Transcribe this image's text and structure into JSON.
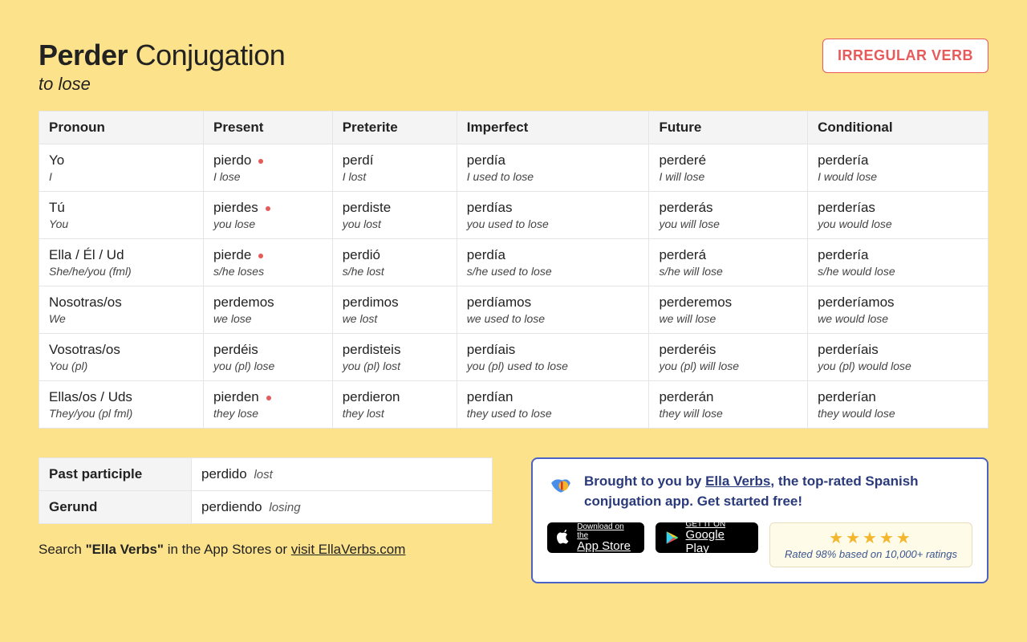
{
  "header": {
    "verb": "Perder",
    "word_conjugation": "Conjugation",
    "translation": "to lose",
    "badge": "IRREGULAR VERB"
  },
  "columns": [
    "Pronoun",
    "Present",
    "Preterite",
    "Imperfect",
    "Future",
    "Conditional"
  ],
  "rows": [
    {
      "pronoun": {
        "es": "Yo",
        "en": "I"
      },
      "present": {
        "es": "pierdo",
        "en": "I lose",
        "irregular": true
      },
      "preterite": {
        "es": "perdí",
        "en": "I lost"
      },
      "imperfect": {
        "es": "perdía",
        "en": "I used to lose"
      },
      "future": {
        "es": "perderé",
        "en": "I will lose"
      },
      "conditional": {
        "es": "perdería",
        "en": "I would lose"
      }
    },
    {
      "pronoun": {
        "es": "Tú",
        "en": "You"
      },
      "present": {
        "es": "pierdes",
        "en": "you lose",
        "irregular": true
      },
      "preterite": {
        "es": "perdiste",
        "en": "you lost"
      },
      "imperfect": {
        "es": "perdías",
        "en": "you used to lose"
      },
      "future": {
        "es": "perderás",
        "en": "you will lose"
      },
      "conditional": {
        "es": "perderías",
        "en": "you would lose"
      }
    },
    {
      "pronoun": {
        "es": "Ella / Él / Ud",
        "en": "She/he/you (fml)"
      },
      "present": {
        "es": "pierde",
        "en": "s/he loses",
        "irregular": true
      },
      "preterite": {
        "es": "perdió",
        "en": "s/he lost"
      },
      "imperfect": {
        "es": "perdía",
        "en": "s/he used to lose"
      },
      "future": {
        "es": "perderá",
        "en": "s/he will lose"
      },
      "conditional": {
        "es": "perdería",
        "en": "s/he would lose"
      }
    },
    {
      "pronoun": {
        "es": "Nosotras/os",
        "en": "We"
      },
      "present": {
        "es": "perdemos",
        "en": "we lose"
      },
      "preterite": {
        "es": "perdimos",
        "en": "we lost"
      },
      "imperfect": {
        "es": "perdíamos",
        "en": "we used to lose"
      },
      "future": {
        "es": "perderemos",
        "en": "we will lose"
      },
      "conditional": {
        "es": "perderíamos",
        "en": "we would lose"
      }
    },
    {
      "pronoun": {
        "es": "Vosotras/os",
        "en": "You (pl)"
      },
      "present": {
        "es": "perdéis",
        "en": "you (pl) lose"
      },
      "preterite": {
        "es": "perdisteis",
        "en": "you (pl) lost"
      },
      "imperfect": {
        "es": "perdíais",
        "en": "you (pl) used to lose"
      },
      "future": {
        "es": "perderéis",
        "en": "you (pl) will lose"
      },
      "conditional": {
        "es": "perderíais",
        "en": "you (pl) would lose"
      }
    },
    {
      "pronoun": {
        "es": "Ellas/os / Uds",
        "en": "They/you (pl fml)"
      },
      "present": {
        "es": "pierden",
        "en": "they lose",
        "irregular": true
      },
      "preterite": {
        "es": "perdieron",
        "en": "they lost"
      },
      "imperfect": {
        "es": "perdían",
        "en": "they used to lose"
      },
      "future": {
        "es": "perderán",
        "en": "they will lose"
      },
      "conditional": {
        "es": "perderían",
        "en": "they would lose"
      }
    }
  ],
  "participles": {
    "past_label": "Past participle",
    "past_es": "perdido",
    "past_en": "lost",
    "gerund_label": "Gerund",
    "gerund_es": "perdiendo",
    "gerund_en": "losing"
  },
  "search_line": {
    "prefix": "Search ",
    "quoted": "\"Ella Verbs\"",
    "middle": " in the App Stores or ",
    "link": "visit EllaVerbs.com"
  },
  "promo": {
    "text_prefix": "Brought to you by ",
    "link": "Ella Verbs",
    "text_suffix": ", the top-rated Spanish conjugation app. Get started free!",
    "appstore_small": "Download on the",
    "appstore_big": "App Store",
    "play_small": "GET IT ON",
    "play_big": "Google Play",
    "stars": "★★★★★",
    "rating_text": "Rated 98% based on 10,000+ ratings"
  }
}
